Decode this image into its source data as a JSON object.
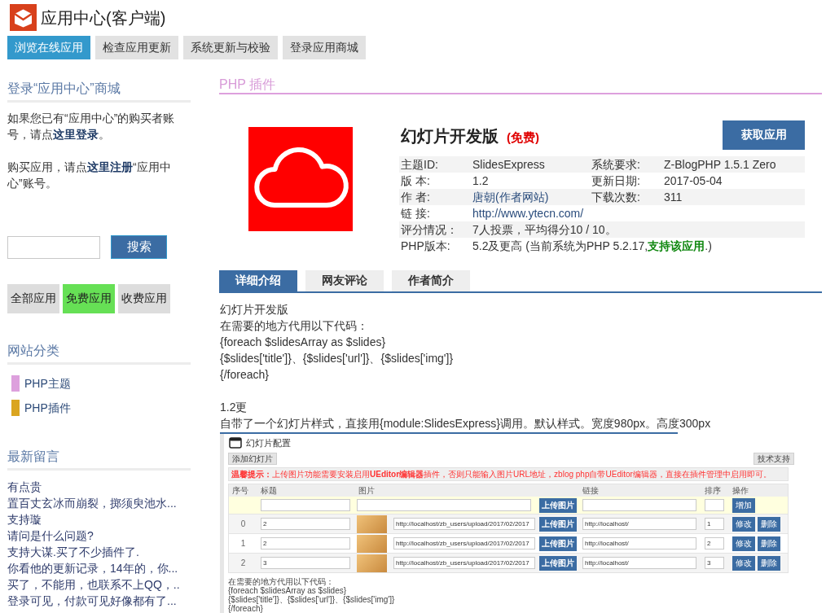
{
  "header": {
    "title": "应用中心(客户端)"
  },
  "nav": [
    {
      "label": "浏览在线应用",
      "selected": true
    },
    {
      "label": "检查应用更新",
      "selected": false
    },
    {
      "label": "系统更新与校验",
      "selected": false
    },
    {
      "label": "登录应用商城",
      "selected": false
    }
  ],
  "sidebar": {
    "login": {
      "heading": "登录“应用中心”商城",
      "paragraphs": [
        [
          {
            "kind": "text",
            "text": "如果您已有“应用中心”的购买者账号，请点"
          },
          {
            "kind": "link",
            "text": "这里登录"
          },
          {
            "kind": "text",
            "text": "。"
          }
        ],
        [
          {
            "kind": "text",
            "text": "购买应用，请点"
          },
          {
            "kind": "link",
            "text": "这里注册"
          },
          {
            "kind": "text",
            "text": "“应用中心”账号。"
          }
        ]
      ]
    },
    "search": {
      "button": "搜索"
    },
    "filters": [
      {
        "label": "全部应用",
        "selected": false
      },
      {
        "label": "免费应用",
        "selected": true
      },
      {
        "label": "收费应用",
        "selected": false
      }
    ],
    "categories": {
      "heading": "网站分类",
      "items": [
        {
          "label": "PHP主题",
          "color": "#dda0dd"
        },
        {
          "label": "PHP插件",
          "color": "#daa520"
        }
      ]
    },
    "messages": {
      "heading": "最新留言",
      "items": [
        "有点贵",
        "置百丈玄冰而崩裂，掷须臾池水...",
        "支持璇",
        "请问是什么问题?",
        "支持大谋.买了不少插件了.",
        "你看他的更新记录，14年的，你...",
        "买了，不能用，也联系不上QQ，..",
        "登录可见，付款可见好像都有了..."
      ]
    }
  },
  "main": {
    "section_title": "PHP 插件",
    "app": {
      "name": "幻灯片开发版",
      "price": "(免费)",
      "action": "获取应用",
      "details": [
        {
          "cells": [
            {
              "label": "主题ID:",
              "value": "SlidesExpress",
              "kind": "text"
            },
            {
              "label": "系统要求:",
              "value": "Z-BlogPHP 1.5.1 Zero",
              "kind": "text"
            }
          ]
        },
        {
          "cells": [
            {
              "label": "版 本:",
              "value": "1.2",
              "kind": "text"
            },
            {
              "label": "更新日期:",
              "value": "2017-05-04",
              "kind": "text"
            }
          ]
        },
        {
          "cells": [
            {
              "label": "作 者:",
              "value": "唐朝(作者网站)",
              "kind": "link"
            },
            {
              "label": "下载次数:",
              "value": "311",
              "kind": "text"
            }
          ]
        },
        {
          "cells": [
            {
              "label": "链 接:",
              "value": "http://www.ytecn.com/",
              "kind": "link"
            }
          ]
        },
        {
          "cells": [
            {
              "label": "评分情况：",
              "value": "7人投票，平均得分10 / 10。",
              "kind": "text"
            }
          ]
        },
        {
          "cells": [
            {
              "label": "PHP版本:",
              "value": "5.2及更高 (当前系统为PHP 5.2.17,**支持该应用**.)",
              "kind": "text"
            }
          ]
        }
      ]
    },
    "tabs": [
      {
        "label": "详细介绍",
        "selected": true
      },
      {
        "label": "网友评论",
        "selected": false
      },
      {
        "label": "作者简介",
        "selected": false
      }
    ],
    "description": [
      {
        "lines": [
          "幻灯片开发版",
          "在需要的地方代用以下代码：",
          "{foreach $slidesArray as $slides}",
          "{$slides['title']}、{$slides['url']}、{$slides['img']}",
          "{/foreach}"
        ]
      },
      {
        "lines": [
          "1.2更",
          "自带了一个幻灯片样式，直接用{module:SlidesExpress}调用。默认样式。宽度980px。高度300px"
        ]
      }
    ],
    "screenshot": {
      "title": "幻灯片配置",
      "add_button": "添加幻灯片",
      "support_button": "技术支持",
      "notice": "**温馨提示：**上传图片功能需要安装启用**UEditor编辑器**插件，否则只能输入图片URL地址，zblog php自带UEditor编辑器，直接在插件管理中启用即可。",
      "columns": [
        "序号",
        "标题",
        "图片",
        "链接",
        "排序",
        "操作"
      ],
      "new_row": {
        "upload": "上传图片",
        "add": "增加"
      },
      "rows": [
        {
          "index": "0",
          "title": "2",
          "image_url": "http://localhost/zb_users/upload/2017/02/2017",
          "upload": "上传图片",
          "link": "http://localhost/",
          "order": "1",
          "edit": "修改",
          "delete": "删除"
        },
        {
          "index": "1",
          "title": "2",
          "image_url": "http://localhost/zb_users/upload/2017/02/2017",
          "upload": "上传图片",
          "link": "http://localhost/",
          "order": "2",
          "edit": "修改",
          "delete": "删除"
        },
        {
          "index": "2",
          "title": "3",
          "image_url": "http://localhost/zb_users/upload/2017/02/2017",
          "upload": "上传图片",
          "link": "http://localhost/",
          "order": "3",
          "edit": "修改",
          "delete": "删除"
        }
      ],
      "code_lines": [
        "在需要的地方代用以下代码：",
        "{foreach $slidesArray as $slides}",
        "{$slides['title']}、{$slides['url']}、{$slides['img']}",
        "{/foreach}"
      ]
    }
  }
}
